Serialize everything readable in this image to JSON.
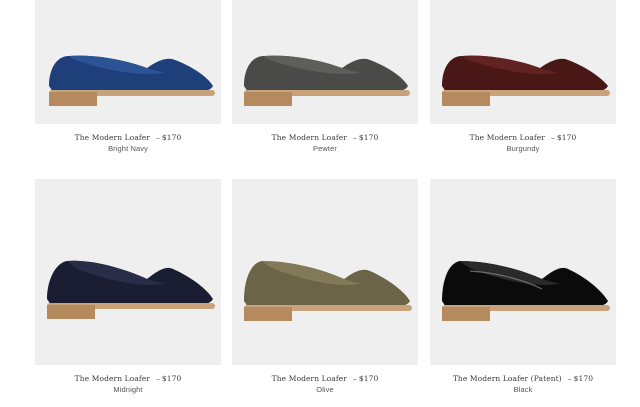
{
  "products": [
    {
      "name": "The Modern Loafer",
      "price": "$170",
      "color": "Bright Navy",
      "upper_color": "#1f3f7a",
      "top_color": "#2c5396"
    },
    {
      "name": "The Modern Loafer",
      "price": "$170",
      "color": "Pewter",
      "upper_color": "#4a4b48",
      "top_color": "#5e5f5b"
    },
    {
      "name": "The Modern Loafer",
      "price": "$170",
      "color": "Burgundy",
      "upper_color": "#4a1717",
      "top_color": "#612222"
    },
    {
      "name": "The Modern Loafer",
      "price": "$170",
      "color": "Midnight",
      "upper_color": "#1b1d33",
      "top_color": "#2a2d48"
    },
    {
      "name": "The Modern Loafer",
      "price": "$170",
      "color": "Olive",
      "upper_color": "#6b6446",
      "top_color": "#827a57"
    },
    {
      "name": "The Modern Loafer (Patent)",
      "price": "$170",
      "color": "Black",
      "upper_color": "#0b0b0b",
      "top_color": "#2a2a2a"
    }
  ],
  "price_separator": "–",
  "sole_color": "#c7a27a",
  "heel_color": "#b58a5e"
}
